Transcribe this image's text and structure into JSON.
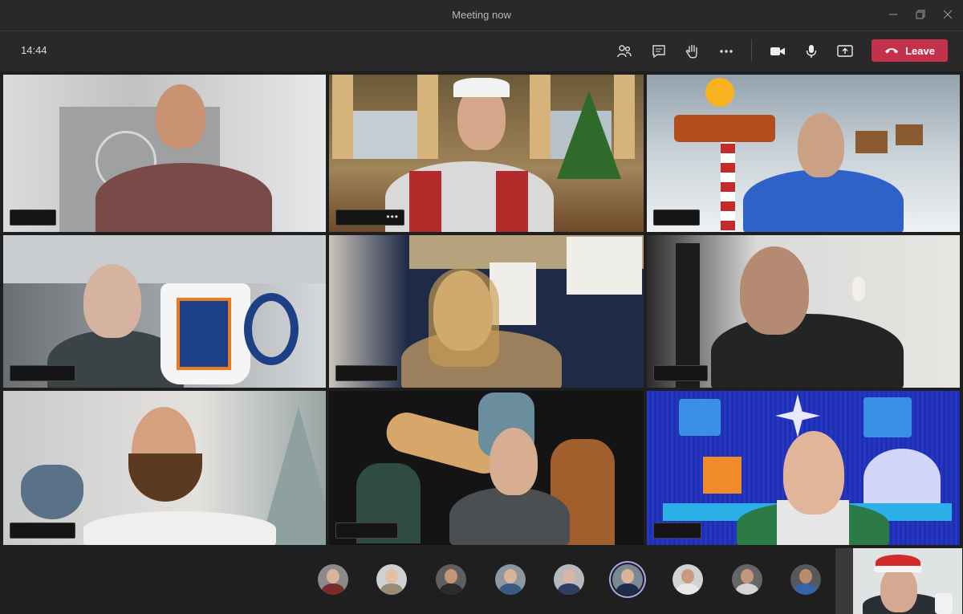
{
  "window": {
    "title": "Meeting now"
  },
  "toolbar": {
    "time": "14:44",
    "leave_label": "Leave",
    "icons": [
      "participants-icon",
      "chat-icon",
      "raise-hand-icon",
      "more-icon",
      "camera-icon",
      "microphone-icon",
      "share-screen-icon"
    ]
  },
  "participants_strip": {
    "count": 9,
    "active_index": 5
  },
  "colors": {
    "leave_button": "#c4314b",
    "active_ring": "#a5a8e8",
    "background": "#1f1f1f",
    "titlebar": "#292929"
  }
}
